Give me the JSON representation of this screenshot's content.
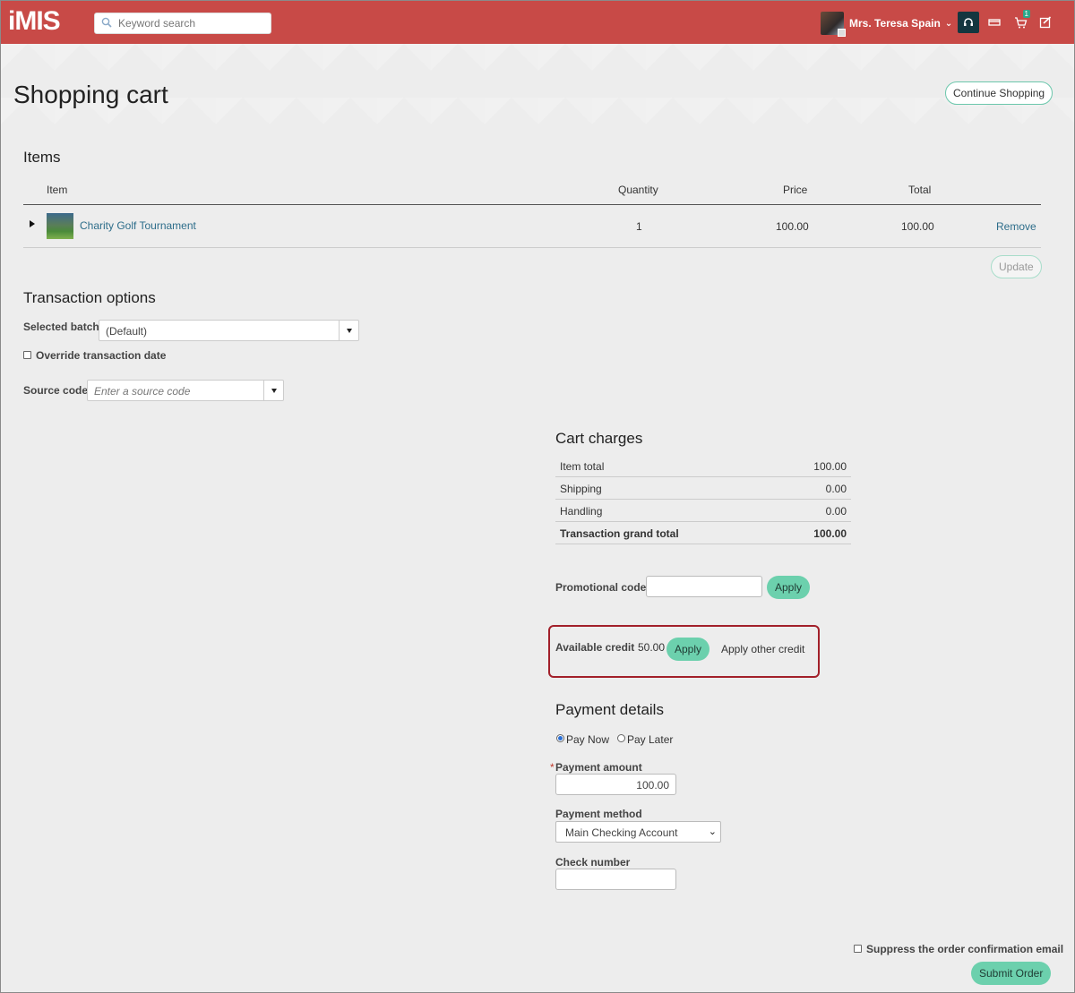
{
  "header": {
    "logo": "iMIS",
    "search_placeholder": "Keyword search",
    "user_name": "Mrs. Teresa Spain",
    "cart_count": "1"
  },
  "page": {
    "title": "Shopping cart",
    "continue_shopping": "Continue Shopping"
  },
  "items": {
    "heading": "Items",
    "columns": {
      "item": "Item",
      "quantity": "Quantity",
      "price": "Price",
      "total": "Total"
    },
    "rows": [
      {
        "name": "Charity Golf Tournament",
        "quantity": "1",
        "price": "100.00",
        "total": "100.00",
        "remove": "Remove"
      }
    ],
    "update": "Update"
  },
  "transaction": {
    "heading": "Transaction options",
    "batch_label": "Selected batch",
    "batch_value": "(Default)",
    "override_label": "Override transaction date",
    "source_label": "Source code",
    "source_placeholder": "Enter a source code"
  },
  "charges": {
    "heading": "Cart charges",
    "rows": [
      {
        "label": "Item total",
        "value": "100.00"
      },
      {
        "label": "Shipping",
        "value": "0.00"
      },
      {
        "label": "Handling",
        "value": "0.00"
      },
      {
        "label": "Transaction grand total",
        "value": "100.00"
      }
    ]
  },
  "promo": {
    "label": "Promotional code",
    "apply": "Apply"
  },
  "credit": {
    "label": "Available credit",
    "amount": "50.00",
    "apply": "Apply",
    "other": "Apply other credit"
  },
  "payment": {
    "heading": "Payment details",
    "pay_now": "Pay Now",
    "pay_later": "Pay Later",
    "required_mark": "*",
    "amount_label": "Payment amount",
    "amount_value": "100.00",
    "method_label": "Payment method",
    "method_value": "Main Checking Account",
    "check_label": "Check number"
  },
  "footer": {
    "suppress_label": "Suppress the order confirmation email",
    "submit": "Submit Order"
  }
}
